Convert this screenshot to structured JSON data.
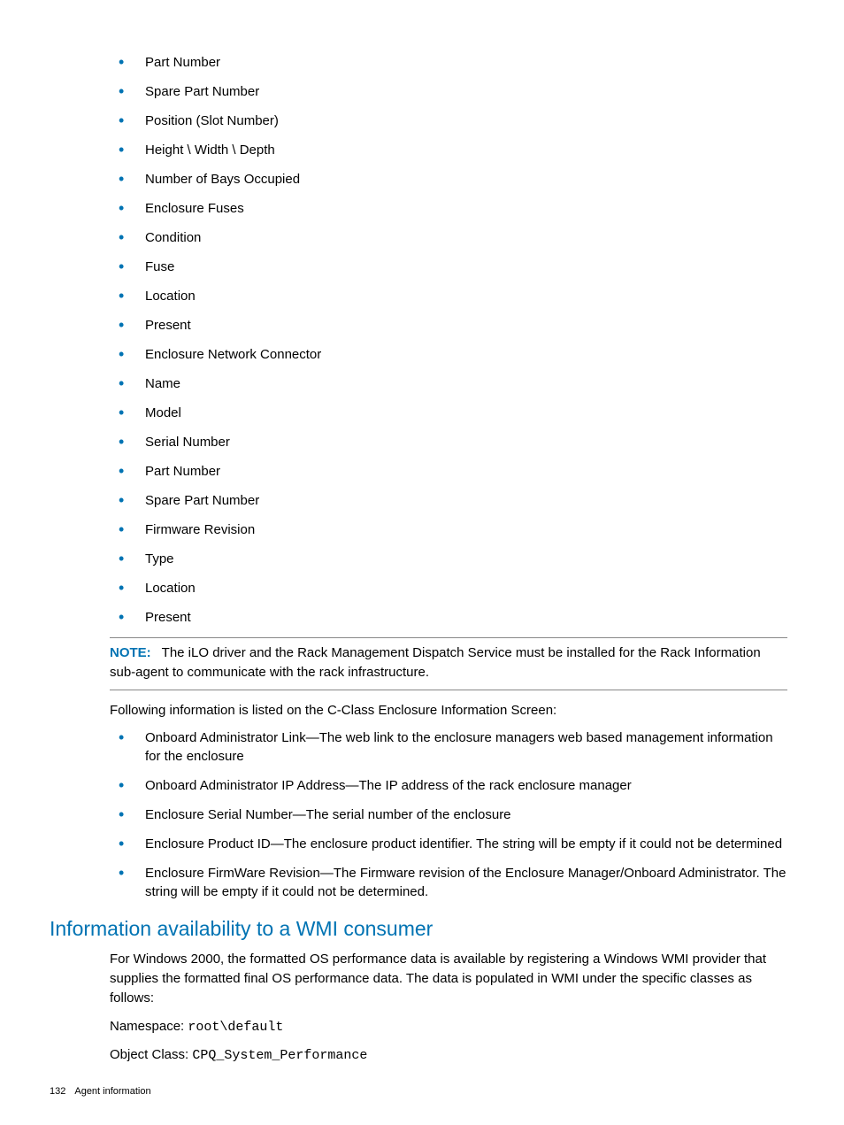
{
  "bullets1": [
    "Part Number",
    "Spare Part Number",
    "Position (Slot Number)",
    "Height \\ Width \\ Depth",
    "Number of Bays Occupied",
    "Enclosure Fuses",
    "Condition",
    "Fuse",
    "Location",
    "Present",
    "Enclosure Network Connector",
    "Name",
    "Model",
    "Serial Number",
    "Part Number",
    "Spare Part Number",
    "Firmware Revision",
    "Type",
    "Location",
    "Present"
  ],
  "note": {
    "label": "NOTE:",
    "text": "The iLO driver and the Rack Management Dispatch Service must be installed for the Rack Information sub-agent to communicate with the rack infrastructure."
  },
  "para1": "Following information is listed on the C-Class Enclosure Information Screen:",
  "bullets2": [
    "Onboard Administrator Link—The web link to the enclosure managers web based management information for the enclosure",
    "Onboard Administrator IP Address—The IP address of the rack enclosure manager",
    "Enclosure Serial Number—The serial number of the enclosure",
    "Enclosure Product ID—The enclosure product identifier. The string will be empty if it could not be determined",
    "Enclosure FirmWare Revision—The Firmware revision of the Enclosure Manager/Onboard Administrator. The string will be empty if it could not be determined."
  ],
  "section_heading": "Information availability to a WMI consumer",
  "para2": "For Windows 2000, the formatted OS performance data is available by registering a Windows WMI provider that supplies the formatted final OS performance data. The data is populated in WMI under the specific classes as follows:",
  "namespace_label": "Namespace: ",
  "namespace_value": "root\\default",
  "objclass_label": "Object Class: ",
  "objclass_value": "CPQ_System_Performance",
  "footer": {
    "page": "132",
    "title": "Agent information"
  }
}
